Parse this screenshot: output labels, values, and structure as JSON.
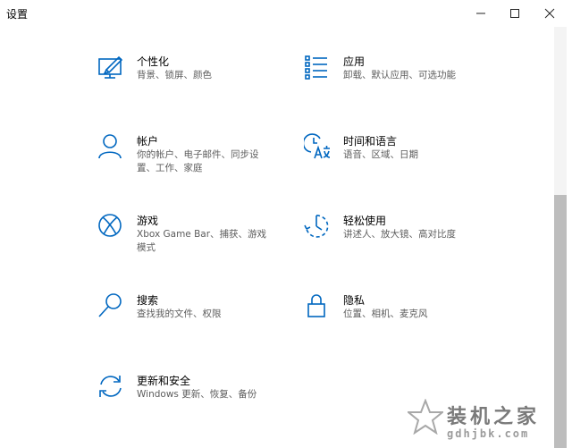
{
  "window": {
    "title": "设置"
  },
  "colors": {
    "accent": "#0067c0",
    "text": "#000000",
    "muted": "#5d5d5d"
  },
  "tiles": [
    {
      "icon": "personalization-icon",
      "name": "个性化",
      "desc": "背景、锁屏、颜色"
    },
    {
      "icon": "apps-icon",
      "name": "应用",
      "desc": "卸载、默认应用、可选功能"
    },
    {
      "icon": "accounts-icon",
      "name": "帐户",
      "desc": "你的帐户、电子邮件、同步设置、工作、家庭"
    },
    {
      "icon": "time-language-icon",
      "name": "时间和语言",
      "desc": "语音、区域、日期"
    },
    {
      "icon": "xbox-icon",
      "name": "游戏",
      "desc": "Xbox Game Bar、捕获、游戏模式"
    },
    {
      "icon": "ease-of-access-icon",
      "name": "轻松使用",
      "desc": "讲述人、放大镜、高对比度"
    },
    {
      "icon": "search-icon",
      "name": "搜索",
      "desc": "查找我的文件、权限"
    },
    {
      "icon": "lock-icon",
      "name": "隐私",
      "desc": "位置、相机、麦克风"
    },
    {
      "icon": "update-icon",
      "name": "更新和安全",
      "desc": "Windows 更新、恢复、备份"
    }
  ],
  "watermark": {
    "text": "装机之家",
    "url": "gdhjbk.com"
  }
}
